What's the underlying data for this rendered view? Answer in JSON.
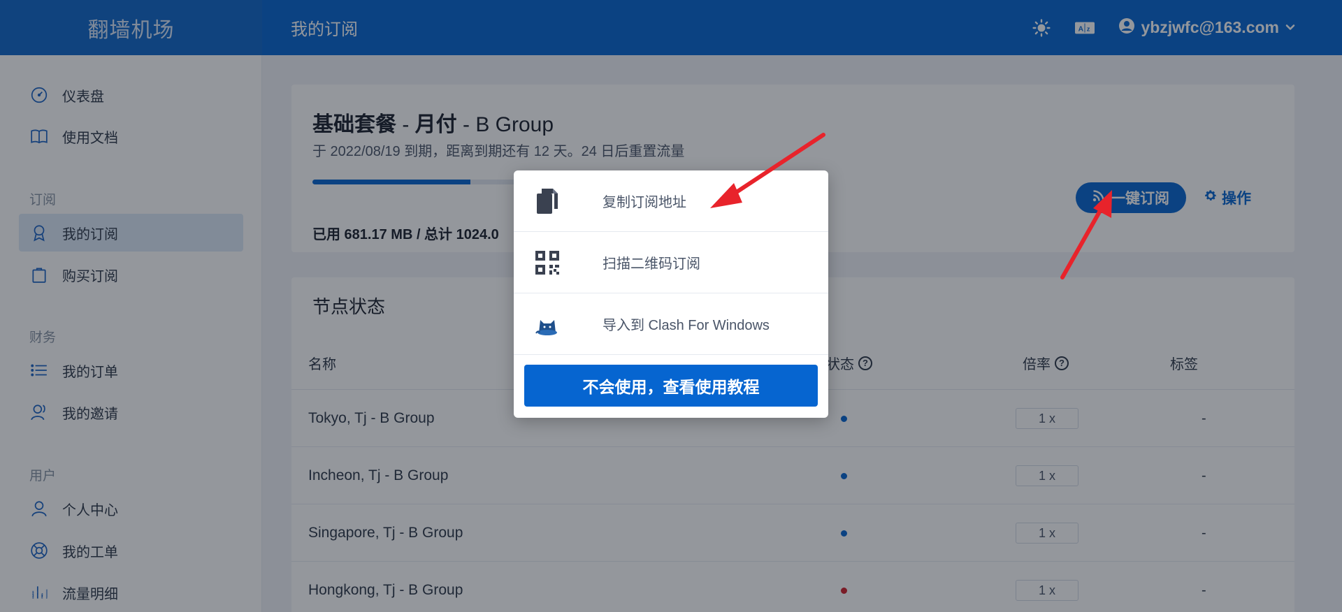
{
  "app": {
    "brand": "翻墙机场",
    "page_title": "我的订阅"
  },
  "header": {
    "user_email": "ybzjwfc@163.com",
    "icons": [
      "theme-sun-icon",
      "translate-icon",
      "user-circle-icon",
      "chevron-down-icon"
    ]
  },
  "sidebar": {
    "items": [
      {
        "label": "仪表盘",
        "icon": "dashboard-icon"
      },
      {
        "label": "使用文档",
        "icon": "book-icon"
      },
      {
        "label": "我的订阅",
        "icon": "ribbon-icon",
        "active": true
      },
      {
        "label": "购买订阅",
        "icon": "bag-icon"
      },
      {
        "label": "我的订单",
        "icon": "list-icon"
      },
      {
        "label": "我的邀请",
        "icon": "invite-icon"
      },
      {
        "label": "个人中心",
        "icon": "person-icon"
      },
      {
        "label": "我的工单",
        "icon": "lifebuoy-icon"
      },
      {
        "label": "流量明细",
        "icon": "chart-icon"
      }
    ],
    "sections": [
      "订阅",
      "财务",
      "用户"
    ]
  },
  "plan": {
    "title_name": "基础套餐",
    "title_dash": " - ",
    "title_cycle": "月付",
    "title_group": " - B Group",
    "subtitle": "于 2022/08/19 到期，距离到期还有 12 天。24 日后重置流量",
    "usage": "已用 681.17 MB / 总计 1024.0",
    "usage_fraction": 0.665,
    "subscribe_button": "一键订阅",
    "ops_button": "操作"
  },
  "nodes": {
    "title": "节点状态",
    "headers": {
      "name": "名称",
      "status": "状态",
      "rate": "倍率",
      "tags": "标签"
    },
    "rows": [
      {
        "name": "Tokyo, Tj - B Group",
        "status_color": "#0665d0",
        "rate": "1 x",
        "tags": "-"
      },
      {
        "name": "Incheon, Tj - B Group",
        "status_color": "#0665d0",
        "rate": "1 x",
        "tags": "-"
      },
      {
        "name": "Singapore, Tj - B Group",
        "status_color": "#0665d0",
        "rate": "1 x",
        "tags": "-"
      },
      {
        "name": "Hongkong, Tj - B Group",
        "status_color": "#d0202a",
        "rate": "1 x",
        "tags": "-"
      }
    ]
  },
  "popup": {
    "items": [
      {
        "label": "复制订阅地址",
        "icon": "copy-icon"
      },
      {
        "label": "扫描二维码订阅",
        "icon": "qrcode-icon"
      },
      {
        "label": "导入到 Clash For Windows",
        "icon": "clash-cat-icon"
      }
    ],
    "help_button": "不会使用，查看使用教程"
  },
  "watermark": "翻墙机场",
  "colors": {
    "primary": "#0665d0",
    "arrow": "#e8232b",
    "offline": "#d0202a"
  }
}
